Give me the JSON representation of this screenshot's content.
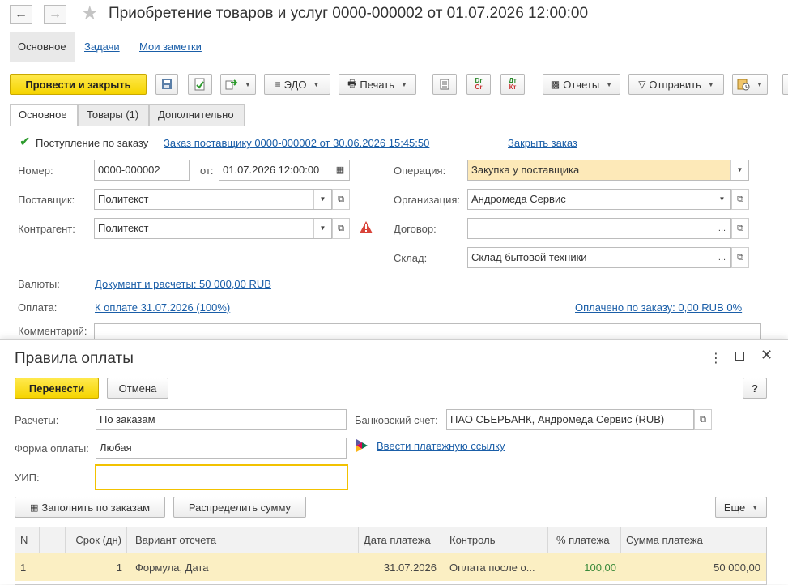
{
  "window": {
    "title": "Приобретение товаров и услуг 0000-000002 от 01.07.2026 12:00:00"
  },
  "sections": [
    "Основное",
    "Задачи",
    "Мои заметки"
  ],
  "toolbar": {
    "post_close": "Провести и закрыть",
    "edo": "ЭДО",
    "print": "Печать",
    "dt_kt_1_top": "Dr",
    "dt_kt_1_bottom": "Cr",
    "dt_kt_2_top": "Дт",
    "dt_kt_2_bottom": "Кт",
    "reports": "Отчеты",
    "send": "Отправить"
  },
  "tabs": [
    "Основное",
    "Товары (1)",
    "Дополнительно"
  ],
  "form": {
    "by_order_label": "Поступление по заказу",
    "by_order_checked": true,
    "order_link": "Заказ поставщику 0000-000002 от 30.06.2026 15:45:50",
    "close_order": "Закрыть заказ",
    "number_label": "Номер:",
    "number": "0000-000002",
    "from_label": "от:",
    "date": "01.07.2026 12:00:00",
    "operation_label": "Операция:",
    "operation": "Закупка у поставщика",
    "supplier_label": "Поставщик:",
    "supplier": "Политекст",
    "org_label": "Организация:",
    "org": "Андромеда Сервис",
    "counterparty_label": "Контрагент:",
    "counterparty": "Политекст",
    "contract_label": "Договор:",
    "contract": "",
    "warehouse_label": "Склад:",
    "warehouse": "Склад бытовой техники",
    "currency_label": "Валюты:",
    "currency_link": "Документ и расчеты: 50 000,00 RUB",
    "payment_label": "Оплата:",
    "payment_link": "К оплате 31.07.2026 (100%)",
    "paid_link": "Оплачено по заказу: 0,00 RUB 0%",
    "comment_label": "Комментарий:",
    "comment": ""
  },
  "dialog": {
    "title": "Правила оплаты",
    "transfer": "Перенести",
    "cancel": "Отмена",
    "help": "?",
    "settlements_label": "Расчеты:",
    "settlements": "По заказам",
    "bank_label": "Банковский счет:",
    "bank": "ПАО СБЕРБАНК, Андромеда Сервис (RUB)",
    "payform_label": "Форма оплаты:",
    "payform": "Любая",
    "pay_link": "Ввести платежную ссылку",
    "uip_label": "УИП:",
    "uip": "",
    "fill_by_orders": "Заполнить по заказам",
    "distribute": "Распределить сумму",
    "more": "Еще",
    "table": {
      "headers": [
        "N",
        "",
        "Срок (дн)",
        "Вариант отсчета",
        "Дата платежа",
        "Контроль",
        "% платежа",
        "Сумма платежа"
      ],
      "rows": [
        [
          "1",
          "",
          "1",
          "Формула, Дата",
          "31.07.2026",
          "Оплата после о...",
          "100,00",
          "50 000,00"
        ]
      ]
    }
  },
  "colors": {
    "accent_yellow": "#f5d400",
    "link": "#1a5ea8",
    "row_highlight": "#fbefc3",
    "field_highlight": "#fde9b8",
    "warning": "#d9443a",
    "percent_green": "#3a8a3a"
  }
}
